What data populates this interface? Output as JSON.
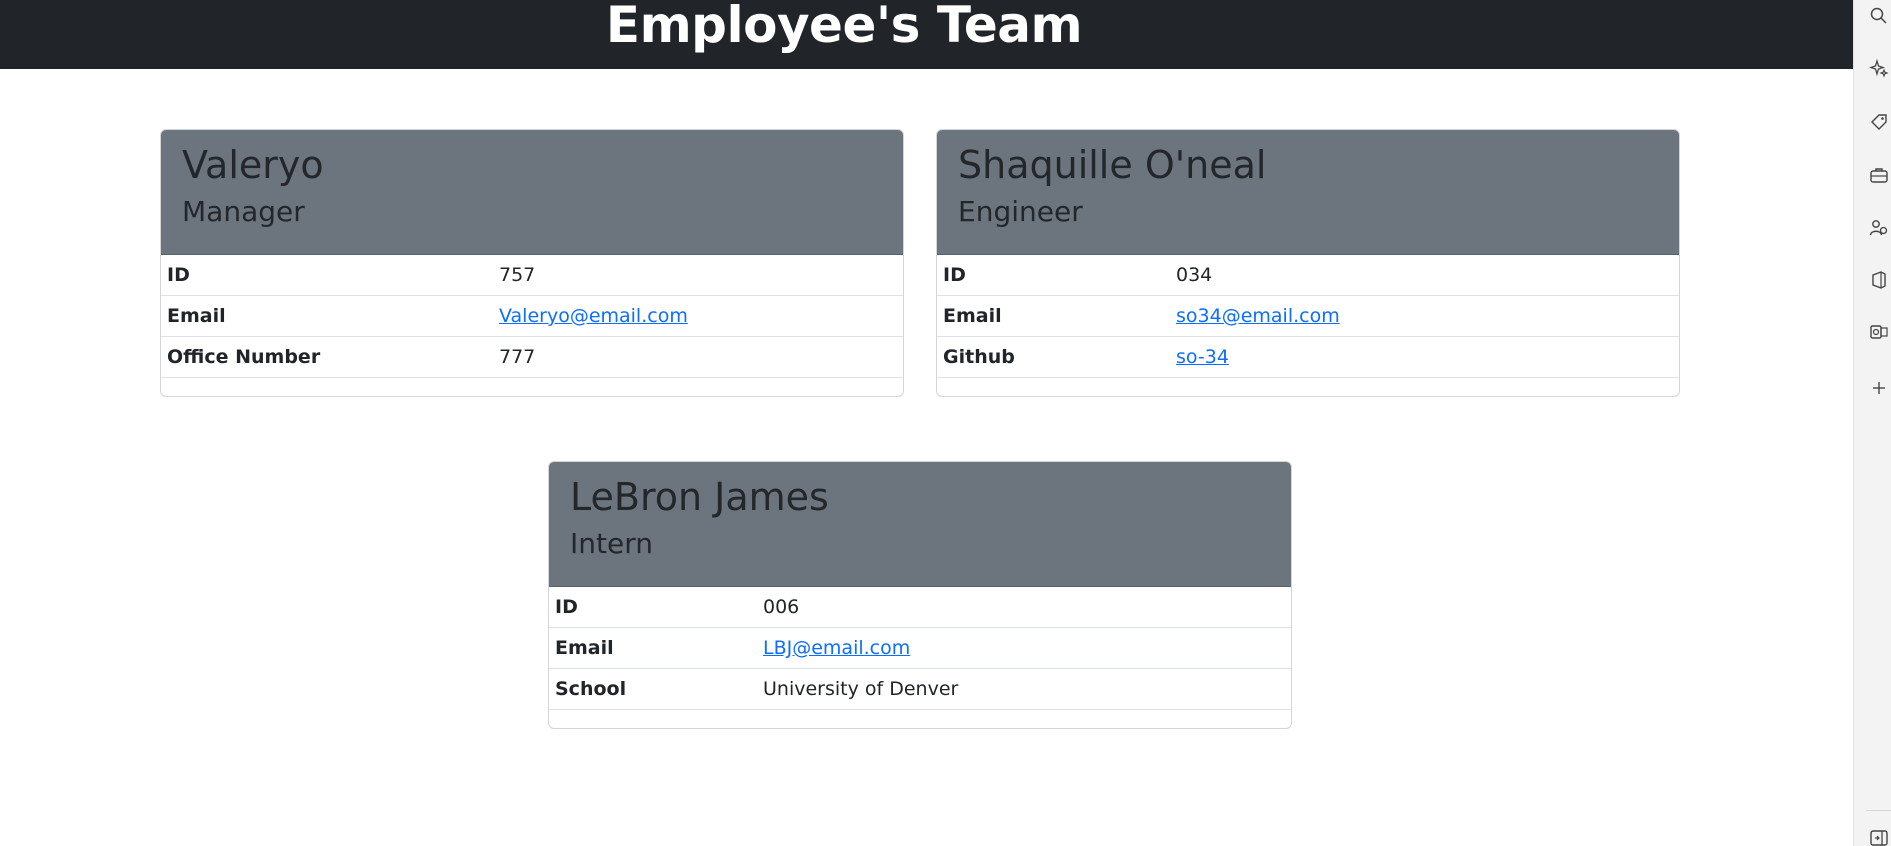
{
  "header": {
    "title": "Employee's Team"
  },
  "employees": [
    {
      "name": "Valeryo",
      "role": "Manager",
      "rows": [
        {
          "label": "ID",
          "value": "757",
          "link": false
        },
        {
          "label": "Email",
          "value": "Valeryo@email.com",
          "link": true
        },
        {
          "label": "Office Number",
          "value": "777",
          "link": false
        }
      ]
    },
    {
      "name": "Shaquille O'neal",
      "role": "Engineer",
      "rows": [
        {
          "label": "ID",
          "value": "034",
          "link": false
        },
        {
          "label": "Email",
          "value": "so34@email.com",
          "link": true
        },
        {
          "label": "Github",
          "value": "so-34",
          "link": true
        }
      ]
    },
    {
      "name": "LeBron James",
      "role": "Intern",
      "rows": [
        {
          "label": "ID",
          "value": "006",
          "link": false
        },
        {
          "label": "Email",
          "value": "LBJ@email.com",
          "link": true
        },
        {
          "label": "School",
          "value": "University of Denver",
          "link": false
        }
      ]
    }
  ],
  "colors": {
    "topbar": "#212529",
    "card_header": "#6c757d",
    "link": "#0d6efd",
    "sidebar": "#f3f3f3"
  },
  "sidebar": {
    "icons": [
      "search-icon",
      "sparkle-icon",
      "tag-icon",
      "briefcase-icon",
      "people-icon",
      "office-icon",
      "outlook-icon",
      "plus-icon",
      "sidebar-collapse-icon"
    ]
  }
}
